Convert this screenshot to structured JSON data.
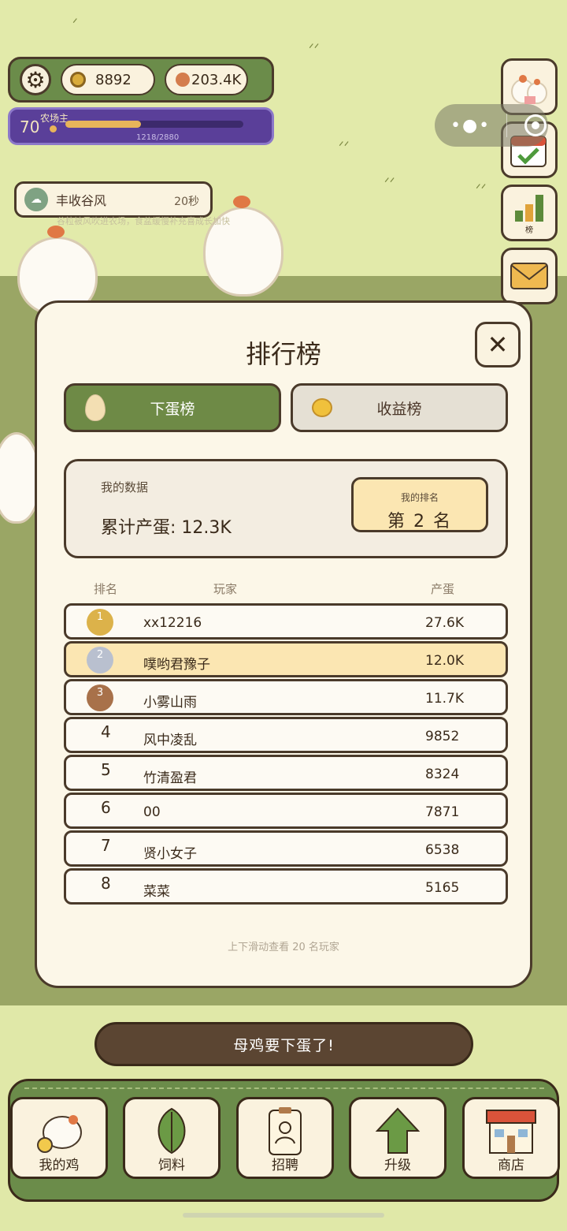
{
  "hud": {
    "coins": "8892",
    "eggs": "203.4K",
    "level": "70",
    "level_title": "农场主",
    "xp_text": "1218/2880",
    "xp_fraction": 0.423
  },
  "weather": {
    "name": "丰收谷风",
    "time": "20秒",
    "desc": "谷粒被风吹进农场，食盆缓慢补充喜成长加快"
  },
  "side_buttons": {
    "rank_label": "榜"
  },
  "modal": {
    "title": "排行榜",
    "close": "✕",
    "tabs": [
      {
        "label": "下蛋榜",
        "active": true
      },
      {
        "label": "收益榜",
        "active": false
      }
    ],
    "my_data": {
      "label": "我的数据",
      "value": "累计产蛋: 12.3K",
      "rank_label": "我的排名",
      "rank_value": "第 2 名"
    },
    "columns": {
      "rank": "排名",
      "player": "玩家",
      "eggs": "产蛋"
    },
    "rows": [
      {
        "rank": "1",
        "name": "xx12216",
        "value": "27.6K"
      },
      {
        "rank": "2",
        "name": "噗哟君豫子",
        "value": "12.0K"
      },
      {
        "rank": "3",
        "name": "小雾山雨",
        "value": "11.7K"
      },
      {
        "rank": "4",
        "name": "风中凌乱",
        "value": "9852"
      },
      {
        "rank": "5",
        "name": "竹清盈君",
        "value": "8324"
      },
      {
        "rank": "6",
        "name": "00",
        "value": "7871"
      },
      {
        "rank": "7",
        "name": "贤小女子",
        "value": "6538"
      },
      {
        "rank": "8",
        "name": "菜菜",
        "value": "5165"
      }
    ],
    "scroll_hint": "上下滑动查看 20 名玩家"
  },
  "lay_button": "母鸡要下蛋了!",
  "nav": [
    {
      "label": "我的鸡",
      "icon": "chicken-icon"
    },
    {
      "label": "饲料",
      "icon": "leaf-icon"
    },
    {
      "label": "招聘",
      "icon": "badge-icon"
    },
    {
      "label": "升级",
      "icon": "arrow-up-icon"
    },
    {
      "label": "商店",
      "icon": "shop-icon"
    }
  ],
  "colors": {
    "accent_green": "#6e8a46",
    "dark_brown": "#4a3a2a",
    "highlight": "#fbe6b2",
    "gold": "#dcb24a",
    "silver": "#b9c0cf",
    "bronze": "#a8714a"
  }
}
